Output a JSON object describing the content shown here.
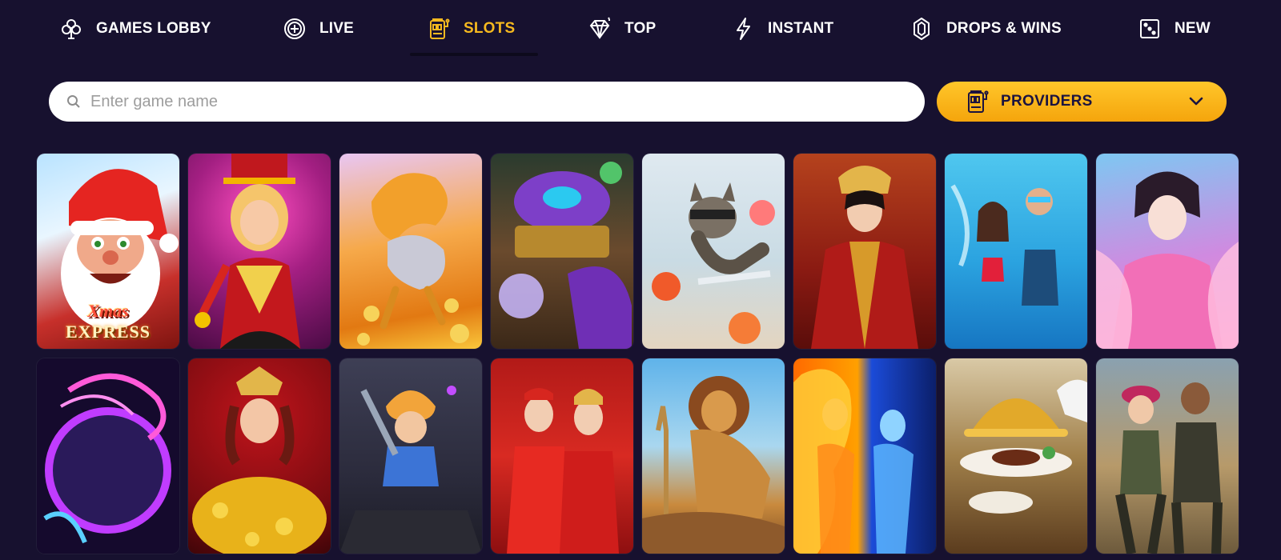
{
  "nav": {
    "items": [
      {
        "label": "GAMES LOBBY",
        "icon": "clover-icon",
        "active": false
      },
      {
        "label": "LIVE",
        "icon": "chip-icon",
        "active": false
      },
      {
        "label": "SLOTS",
        "icon": "slot-machine-icon",
        "active": true
      },
      {
        "label": "TOP",
        "icon": "diamond-icon",
        "active": false
      },
      {
        "label": "INSTANT",
        "icon": "lightning-icon",
        "active": false
      },
      {
        "label": "DROPS & WINS",
        "icon": "gem-icon",
        "active": false
      },
      {
        "label": "NEW",
        "icon": "dice-icon",
        "active": false
      }
    ],
    "active_color": "#f6b91f"
  },
  "search": {
    "placeholder": "Enter game name",
    "icon": "search-icon"
  },
  "providers": {
    "label": "PROVIDERS",
    "icon": "slot-machine-icon",
    "dropdown_icon": "chevron-down-icon",
    "accent": "#f8b21a"
  },
  "games": {
    "row1": [
      {
        "name": "xmas-express",
        "logo_top": "Xmas",
        "logo_bottom": "EXPRESS"
      },
      {
        "name": "circus-showgirl"
      },
      {
        "name": "golden-qilin"
      },
      {
        "name": "wizard-treasure"
      },
      {
        "name": "ninja-raccoon"
      },
      {
        "name": "chinese-empress"
      },
      {
        "name": "water-fight"
      },
      {
        "name": "pink-princess"
      }
    ],
    "row2": [
      {
        "name": "neon-dragon-tiger"
      },
      {
        "name": "roses-queen"
      },
      {
        "name": "sword-hero"
      },
      {
        "name": "wedding-couple"
      },
      {
        "name": "safari-lion"
      },
      {
        "name": "fire-ice-spirits"
      },
      {
        "name": "golden-dinner"
      },
      {
        "name": "survivors-duo"
      }
    ]
  },
  "colors": {
    "background": "#17112f",
    "nav_text": "#ffffff"
  }
}
